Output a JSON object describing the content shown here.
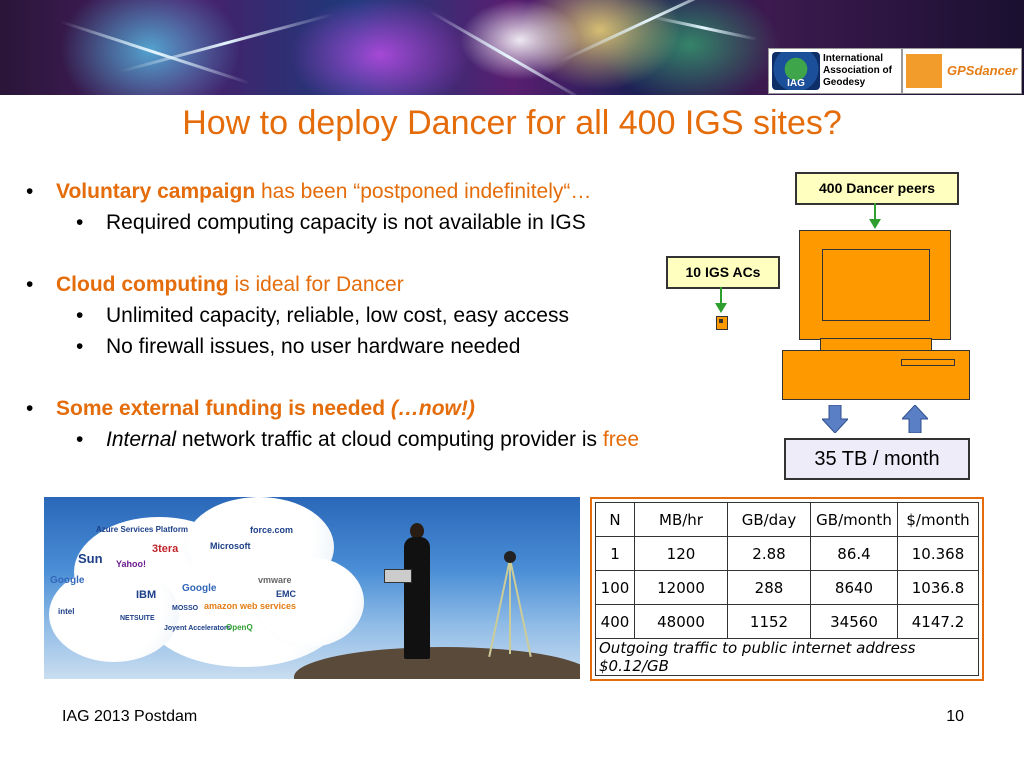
{
  "header": {
    "iag_logo": {
      "emblem_text": "IAG",
      "name_lines": [
        "International",
        "Association of",
        "Geodesy"
      ]
    },
    "gps_logo": {
      "text": "GPSdancer"
    }
  },
  "slide": {
    "title": "How to deploy Dancer for all 400 IGS sites?",
    "bullets": {
      "b1": {
        "strong": "Voluntary campaign",
        "rest": " has been “postponed indefinitely“…"
      },
      "b1_sub": "Required computing capacity is not available in IGS",
      "b2": {
        "strong": "Cloud computing",
        "rest": " is ideal for Dancer"
      },
      "b2_sub1": "Unlimited capacity, reliable, low cost, easy access",
      "b2_sub2": "No firewall issues, no user hardware needed",
      "b3": {
        "text": "Some external funding is needed ",
        "italic": "(…now!)"
      },
      "b3_sub": {
        "italic": "Internal",
        "rest": " network traffic at cloud computing provider is ",
        "free": "free"
      }
    }
  },
  "diagram": {
    "peers_label": "400 Dancer peers",
    "acs_label": "10 IGS ACs",
    "traffic_label": "35 TB / month",
    "colors": {
      "computer": "#ff9900",
      "arrow_green": "#2e9e2e",
      "arrow_blue": "#5b7fc4",
      "label_bg": "#ffffc0"
    }
  },
  "photo": {
    "cloud_labels": [
      "Azure Services Platform",
      "3tera",
      "Microsoft",
      "force.com",
      "Sun",
      "Yahoo!",
      "Google",
      "IBM",
      "Google",
      "vmware",
      "EMC",
      "amazon web services",
      "NETSUITE",
      "MOSSO",
      "Joyent Accelerators",
      "OpenQ",
      "intel"
    ]
  },
  "cost_table": {
    "headers": [
      "N",
      "MB/hr",
      "GB/day",
      "GB/month",
      "$/month"
    ],
    "rows": [
      [
        "1",
        "120",
        "2.88",
        "86.4",
        "10.368"
      ],
      [
        "100",
        "12000",
        "288",
        "8640",
        "1036.8"
      ],
      [
        "400",
        "48000",
        "1152",
        "34560",
        "4147.2"
      ]
    ],
    "note": "Outgoing traffic to public internet address $0.12/GB"
  },
  "footer": {
    "left": "IAG 2013 Postdam",
    "page_number": "10"
  },
  "theme": {
    "accent": "#e46c0a"
  }
}
